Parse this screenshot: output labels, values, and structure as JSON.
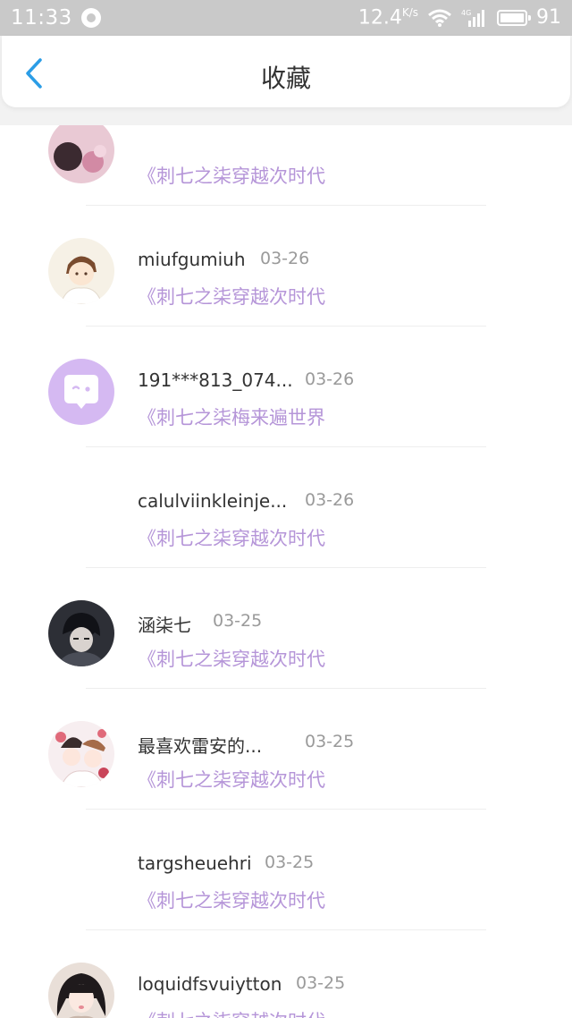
{
  "status_bar": {
    "time": "11:33",
    "net_speed": "12.4",
    "net_unit": "K/s",
    "net_type": "4G",
    "battery": "91"
  },
  "header": {
    "title": "收藏"
  },
  "items": [
    {
      "name": "",
      "date": "",
      "book": "《刺七之柒穿越次时代",
      "avatar": "avatar-image"
    },
    {
      "name": "miufgumiuh",
      "date": "03-26",
      "book": "《刺七之柒穿越次时代",
      "avatar": "avatar-image"
    },
    {
      "name": "191***813_074...",
      "date": "03-26",
      "book": "《刺七之柒梅来遍世界",
      "avatar": "chat-bubble-icon"
    },
    {
      "name": "calulviinkleinje...",
      "date": "03-26",
      "book": "《刺七之柒穿越次时代",
      "avatar": "none"
    },
    {
      "name": "涵柒七",
      "date": "03-25",
      "book": "《刺七之柒穿越次时代",
      "avatar": "avatar-image"
    },
    {
      "name": "最喜欢雷安的...",
      "date": "03-25",
      "book": "《刺七之柒穿越次时代",
      "avatar": "avatar-image"
    },
    {
      "name": "targsheuehri",
      "date": "03-25",
      "book": "《刺七之柒穿越次时代",
      "avatar": "none"
    },
    {
      "name": "loquidfsvuiytton",
      "date": "03-25",
      "book": "《刺七之柒穿越次时代",
      "avatar": "avatar-image"
    }
  ],
  "colors": {
    "accent": "#2b9de6",
    "book_title": "#b595d8",
    "status_bar": "#c9c9c9"
  }
}
